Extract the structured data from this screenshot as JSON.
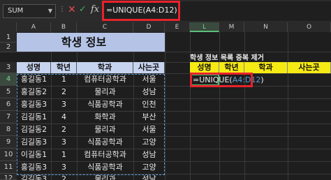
{
  "formula_bar": {
    "name_box": "SUM",
    "dots": "⋮",
    "cancel_icon": "✕",
    "enter_icon": "✓",
    "fx_label": "fx",
    "formula": "=UNIQUE(A4:D12)"
  },
  "columns": [
    "A",
    "B",
    "C",
    "D",
    "E",
    "L",
    "M",
    "N",
    "O"
  ],
  "active_column": "L",
  "rows": [
    "1",
    "2",
    "3",
    "4",
    "5",
    "6",
    "7",
    "8",
    "9",
    "10",
    "11",
    "12"
  ],
  "active_row": "4",
  "sheet": {
    "title": "학생 정보",
    "headers": [
      "성명",
      "학년",
      "학과",
      "사는곳"
    ],
    "data": [
      [
        "홍길동1",
        "1",
        "컴퓨터공학과",
        "서울"
      ],
      [
        "홍길동2",
        "2",
        "물리과",
        "성남"
      ],
      [
        "홍길동3",
        "3",
        "식품공학과",
        "인천"
      ],
      [
        "김길동1",
        "4",
        "화학과",
        "부산"
      ],
      [
        "김길동2",
        "2",
        "물리과",
        "서울"
      ],
      [
        "김길동3",
        "3",
        "식품공학과",
        "고양"
      ],
      [
        "이길동1",
        "1",
        "컴퓨터공학과",
        "성남"
      ],
      [
        "홍길동3",
        "3",
        "식품공학과",
        "고양"
      ],
      [
        "김길동3",
        "2",
        "물리과",
        "성남"
      ]
    ]
  },
  "result": {
    "title": "학생 정보 목록 중복 제거",
    "headers": [
      "성명",
      "학년",
      "학과",
      "사는곳"
    ],
    "cell_formula_prefix": "=UNIQUE(",
    "cell_formula_ref": "A4:D12",
    "cell_formula_suffix": ")"
  },
  "colors": {
    "title_fill": "#b4c3e6",
    "header_fill": "#c7d4ef",
    "result_header_fill": "#f6ea14",
    "highlight_red": "#e8222b",
    "active_green": "#4cba6a",
    "ref_blue": "#5b9bd5"
  }
}
